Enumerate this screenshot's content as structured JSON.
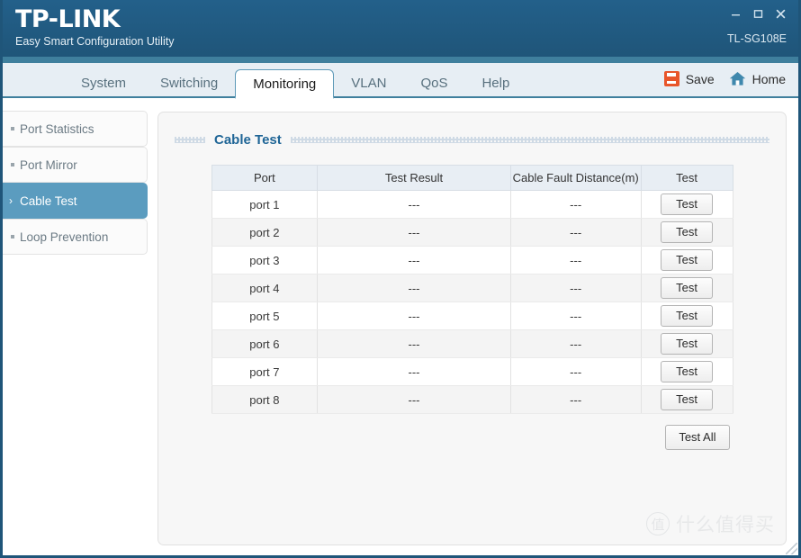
{
  "window": {
    "brand_name": "TP-LINK",
    "brand_subtitle": "Easy Smart Configuration Utility",
    "model": "TL-SG108E",
    "controls": {
      "minimize": "minimize-icon",
      "maximize": "maximize-icon",
      "close": "close-icon"
    }
  },
  "nav": {
    "tabs": [
      {
        "label": "System",
        "active": false
      },
      {
        "label": "Switching",
        "active": false
      },
      {
        "label": "Monitoring",
        "active": true
      },
      {
        "label": "VLAN",
        "active": false
      },
      {
        "label": "QoS",
        "active": false
      },
      {
        "label": "Help",
        "active": false
      }
    ],
    "tools": [
      {
        "label": "Save",
        "icon": "save-icon"
      },
      {
        "label": "Home",
        "icon": "home-icon"
      }
    ]
  },
  "sidebar": {
    "items": [
      {
        "label": "Port Statistics",
        "active": false
      },
      {
        "label": "Port Mirror",
        "active": false
      },
      {
        "label": "Cable Test",
        "active": true
      },
      {
        "label": "Loop Prevention",
        "active": false
      }
    ],
    "active_marker": "›"
  },
  "panel": {
    "title": "Cable Test"
  },
  "table": {
    "columns": [
      "Port",
      "Test Result",
      "Cable Fault Distance(m)",
      "Test"
    ],
    "rows": [
      {
        "port": "port 1",
        "result": "---",
        "distance": "---",
        "action": "Test"
      },
      {
        "port": "port 2",
        "result": "---",
        "distance": "---",
        "action": "Test"
      },
      {
        "port": "port 3",
        "result": "---",
        "distance": "---",
        "action": "Test"
      },
      {
        "port": "port 4",
        "result": "---",
        "distance": "---",
        "action": "Test"
      },
      {
        "port": "port 5",
        "result": "---",
        "distance": "---",
        "action": "Test"
      },
      {
        "port": "port 6",
        "result": "---",
        "distance": "---",
        "action": "Test"
      },
      {
        "port": "port 7",
        "result": "---",
        "distance": "---",
        "action": "Test"
      },
      {
        "port": "port 8",
        "result": "---",
        "distance": "---",
        "action": "Test"
      }
    ]
  },
  "actions": {
    "test_all": "Test All"
  },
  "watermark": {
    "mark": "值",
    "text": "什么值得买"
  },
  "colors": {
    "header_bg": "#1f5579",
    "accent_strip": "#3f7f9d",
    "tabbar_bg": "#e7eef4",
    "sidebar_active": "#5b9cbf",
    "panel_title": "#1f6596",
    "save_icon": "#e8552a",
    "home_icon": "#3f88ad",
    "table_header_bg": "#e8eef4"
  }
}
